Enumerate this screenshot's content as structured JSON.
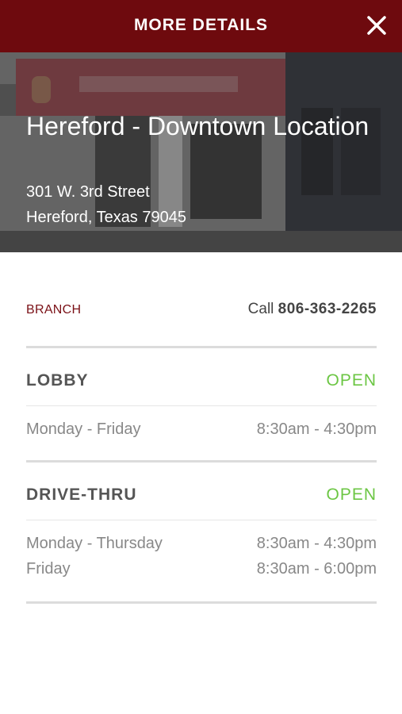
{
  "header": {
    "title": "MORE DETAILS",
    "close_icon": "close-icon"
  },
  "location": {
    "name": "Hereford - Downtown Location",
    "address_line1": "301 W. 3rd Street",
    "address_line2": "Hereford, Texas 79045"
  },
  "branch": {
    "label": "BRANCH",
    "call_prefix": "Call",
    "phone": "806-363-2265"
  },
  "lobby": {
    "title": "LOBBY",
    "status": "OPEN",
    "hours": [
      {
        "day": "Monday - Friday",
        "time": "8:30am - 4:30pm"
      }
    ]
  },
  "drive_thru": {
    "title": "DRIVE-THRU",
    "status": "OPEN",
    "hours": [
      {
        "day": "Monday - Thursday",
        "time": "8:30am - 4:30pm"
      },
      {
        "day": "Friday",
        "time": "8:30am - 6:00pm"
      }
    ]
  },
  "colors": {
    "header_bg": "#6e0a0e",
    "brand_red": "#7a1016",
    "open_green": "#6cc644",
    "divider": "#dcdcdc"
  }
}
